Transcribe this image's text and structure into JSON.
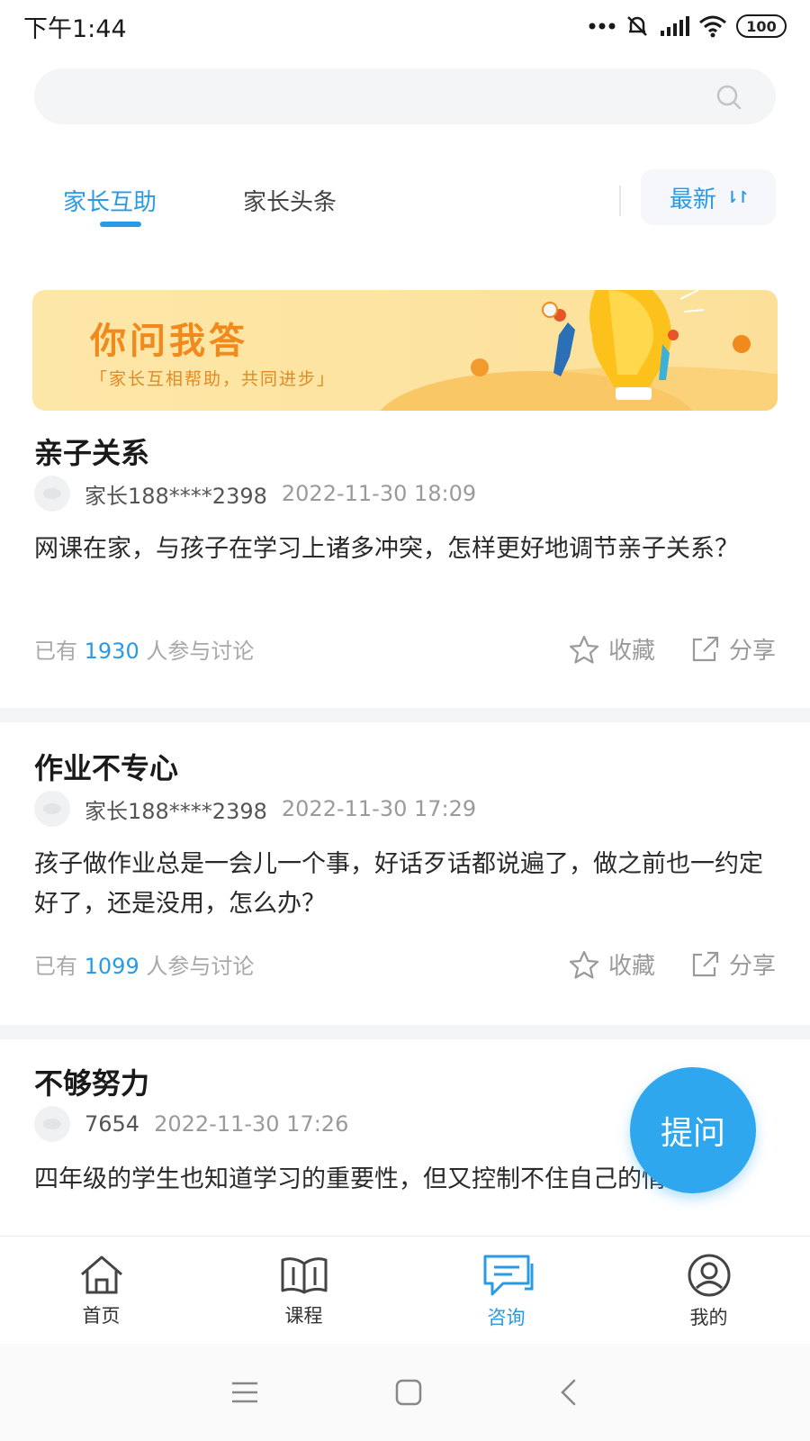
{
  "status_bar": {
    "time": "下午1:44",
    "battery": "100"
  },
  "tabs": [
    {
      "label": "家长互助",
      "active": true
    },
    {
      "label": "家长头条",
      "active": false
    }
  ],
  "sort": {
    "label": "最新",
    "icon": "sort-arrows-icon"
  },
  "banner": {
    "title": "你问我答",
    "subtitle": "「家长互相帮助，共同进步」"
  },
  "posts": [
    {
      "title": "亲子关系",
      "author": "家长188****2398",
      "time": "2022-11-30 18:09",
      "body": "网课在家，与孩子在学习上诸多冲突，怎样更好地调节亲子关系？",
      "discuss_prefix": "已有",
      "discuss_count": "1930",
      "discuss_suffix": "人参与讨论",
      "favorite_label": "收藏",
      "share_label": "分享"
    },
    {
      "title": "作业不专心",
      "author": "家长188****2398",
      "time": "2022-11-30 17:29",
      "body": "孩子做作业总是一会儿一个事，好话歹话都说遍了，做之前也一约定好了，还是没用，怎么办？",
      "discuss_prefix": "已有",
      "discuss_count": "1099",
      "discuss_suffix": "人参与讨论",
      "favorite_label": "收藏",
      "share_label": "分享"
    },
    {
      "title": "不够努力",
      "author": "7654",
      "time": "2022-11-30 17:26",
      "body": "四年级的学生也知道学习的重要性，但又控制不住自己的情绪"
    }
  ],
  "fab": {
    "label": "提问"
  },
  "bottom_nav": [
    {
      "label": "首页",
      "icon": "home-icon",
      "active": false
    },
    {
      "label": "课程",
      "icon": "book-icon",
      "active": false
    },
    {
      "label": "咨询",
      "icon": "chat-icon",
      "active": true
    },
    {
      "label": "我的",
      "icon": "profile-icon",
      "active": false
    }
  ],
  "colors": {
    "accent": "#2a9ae4",
    "banner_bg": "#fde3a0",
    "banner_text": "#f08a1c",
    "fab": "#2ea7ee"
  }
}
